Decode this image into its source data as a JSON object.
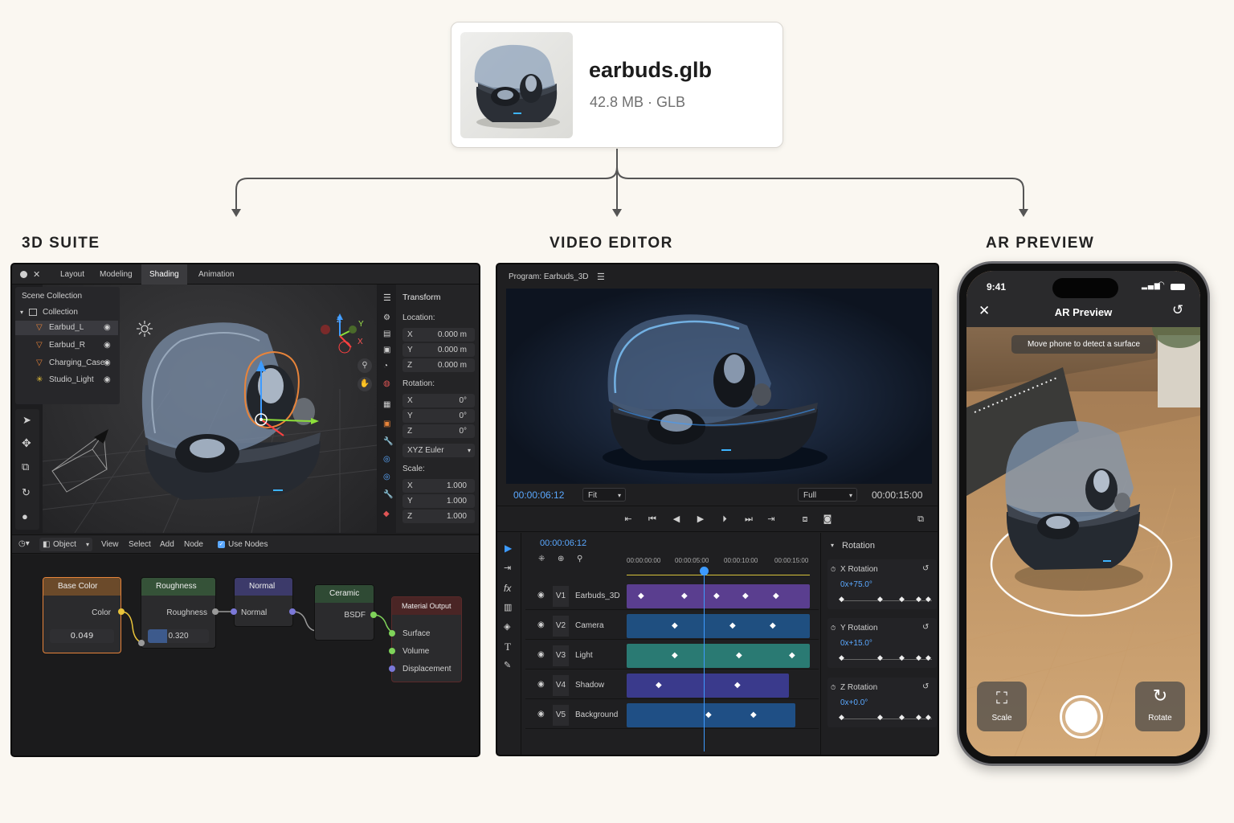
{
  "file": {
    "name": "earbuds.glb",
    "meta": "42.8 MB · GLB"
  },
  "sections": {
    "suite": "3D SUITE",
    "video": "VIDEO EDITOR",
    "ar": "AR PREVIEW"
  },
  "suite": {
    "tabs": [
      "Layout",
      "Modeling",
      "Shading",
      "Animation"
    ],
    "active_tab": "Shading",
    "outliner": {
      "title": "Scene Collection",
      "collection": "Collection",
      "items": [
        "Earbud_L",
        "Earbud_R",
        "Charging_Case",
        "Studio_Light"
      ],
      "selected": "Earbud_L"
    },
    "transform": {
      "title": "Transform",
      "location_label": "Location:",
      "location": [
        {
          "axis": "X",
          "value": "0.000 m"
        },
        {
          "axis": "Y",
          "value": "0.000 m"
        },
        {
          "axis": "Z",
          "value": "0.000 m"
        }
      ],
      "rotation_label": "Rotation:",
      "rotation": [
        {
          "axis": "X",
          "value": "0°"
        },
        {
          "axis": "Y",
          "value": "0°"
        },
        {
          "axis": "Z",
          "value": "0°"
        }
      ],
      "rotation_mode": "XYZ Euler",
      "scale_label": "Scale:",
      "scale": [
        {
          "axis": "X",
          "value": "1.000"
        },
        {
          "axis": "Y",
          "value": "1.000"
        },
        {
          "axis": "Z",
          "value": "1.000"
        }
      ]
    },
    "gizmo_axes": {
      "x": "X",
      "y": "Y",
      "z": "Z"
    },
    "nodebar": {
      "mode": "Object",
      "menus": [
        "View",
        "Select",
        "Add",
        "Node"
      ],
      "use_nodes": "Use Nodes"
    },
    "nodes": {
      "base_color": {
        "title": "Base Color",
        "output": "Color",
        "value": "0.049"
      },
      "roughness": {
        "title": "Roughness",
        "output": "Roughness",
        "value": "0.320",
        "fill_fraction": 0.32
      },
      "normal": {
        "title": "Normal",
        "output": "Normal"
      },
      "ceramic": {
        "title": "Ceramic",
        "output": "BSDF"
      },
      "material_output": {
        "title": "Material Output",
        "inputs": [
          "Surface",
          "Volume",
          "Displacement"
        ]
      }
    },
    "colors": {
      "accent": "#e8843a",
      "active_tab": "#3b3b3e"
    }
  },
  "video": {
    "program": "Program: Earbuds_3D",
    "current_time": "00:00:06:12",
    "fit": "Fit",
    "quality": "Full",
    "duration": "00:00:15:00",
    "timeline_time": "00:00:06:12",
    "ruler": [
      "00:00:00:00",
      "00:00:05:00",
      "00:00:10:00",
      "00:00:15:00"
    ],
    "tracks": [
      {
        "id": "V1",
        "name": "Earbuds_3D",
        "color": "#5a3e8f"
      },
      {
        "id": "V2",
        "name": "Camera",
        "color": "#1f4f80"
      },
      {
        "id": "V3",
        "name": "Light",
        "color": "#2a7a73"
      },
      {
        "id": "V4",
        "name": "Shadow",
        "color": "#3a3a8c"
      },
      {
        "id": "V5",
        "name": "Background",
        "color": "#1f4f85"
      }
    ],
    "effect_panel": {
      "title": "Rotation",
      "params": [
        {
          "label": "X Rotation",
          "value": "0x+75.0°"
        },
        {
          "label": "Y Rotation",
          "value": "0x+15.0°"
        },
        {
          "label": "Z Rotation",
          "value": "0x+0.0°"
        }
      ]
    },
    "colors": {
      "accent": "#3d9bff",
      "playhead": "#3d9bff"
    }
  },
  "ar": {
    "time": "9:41",
    "title": "AR Preview",
    "hint": "Move phone to detect a surface",
    "scale_label": "Scale",
    "rotate_label": "Rotate"
  }
}
